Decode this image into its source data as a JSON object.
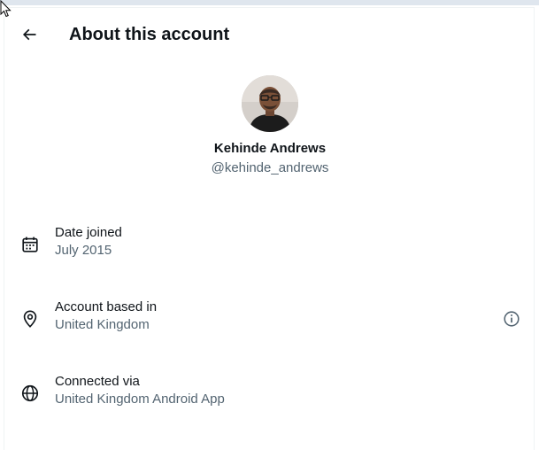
{
  "header": {
    "title": "About this account"
  },
  "profile": {
    "display_name": "Kehinde Andrews",
    "handle": "@kehinde_andrews"
  },
  "details": {
    "date_joined": {
      "label": "Date joined",
      "value": "July 2015",
      "icon": "calendar-icon"
    },
    "account_based_in": {
      "label": "Account based in",
      "value": "United Kingdom",
      "icon": "location-pin-icon"
    },
    "connected_via": {
      "label": "Connected via",
      "value": "United Kingdom Android App",
      "icon": "globe-icon"
    }
  },
  "colors": {
    "text_primary": "#0f1419",
    "text_secondary": "#536471",
    "divider": "#eff3f4"
  }
}
